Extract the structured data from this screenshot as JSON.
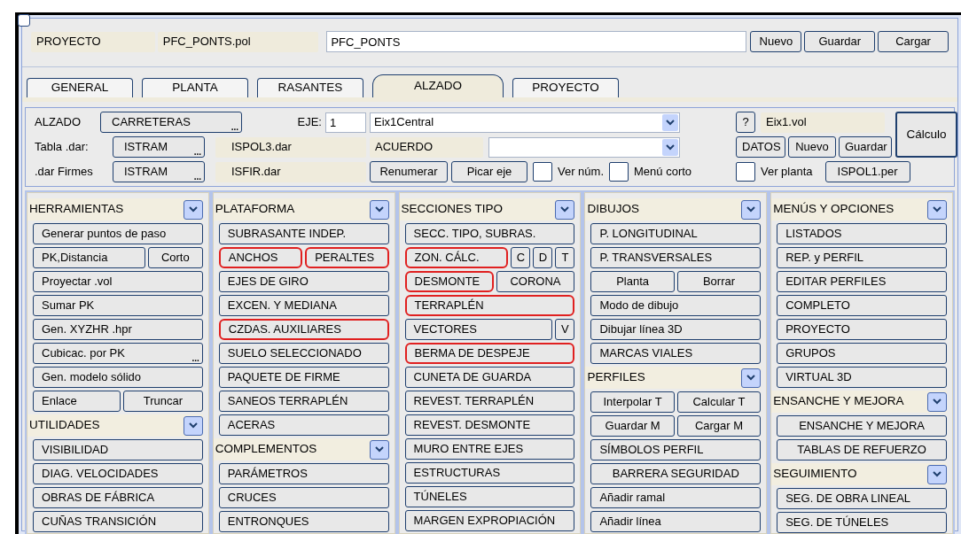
{
  "project": {
    "label": "PROYECTO",
    "file": "PFC_PONTS.pol",
    "name": "PFC_PONTS",
    "buttons": [
      "Nuevo",
      "Guardar",
      "Cargar"
    ]
  },
  "tabs": [
    {
      "label": "GENERAL",
      "selected": false
    },
    {
      "label": "PLANTA",
      "selected": false
    },
    {
      "label": "RASANTES",
      "selected": false
    },
    {
      "label": "ALZADO",
      "selected": true
    },
    {
      "label": "PROYECTO",
      "selected": false
    }
  ],
  "alzado": {
    "label": "ALZADO",
    "road_button": {
      "label": "CARRETERAS",
      "ellipsis": "..."
    },
    "eje_label": "EJE:",
    "eje_value": "1",
    "eje_combo": "Eix1Central",
    "help_button": "?",
    "vol_file": "Eix1.vol",
    "calc_button": "Cálculo",
    "tabla_label": "Tabla .dar:",
    "tabla_button": {
      "label": "ISTRAM",
      "ellipsis": "..."
    },
    "tabla_file": "ISPOL3.dar",
    "acuerdo_label": "ACUERDO",
    "datos_button": "DATOS",
    "nuevo_button": "Nuevo",
    "guardar_button": "Guardar",
    "firmes_label": ".dar Firmes",
    "firmes_button": {
      "label": "ISTRAM",
      "ellipsis": "..."
    },
    "firmes_file": "ISFIR.dar",
    "renumerar_button": "Renumerar",
    "picar_button": "Picar eje",
    "checks": [
      {
        "label": "Ver núm.",
        "checked": false
      },
      {
        "label": "Menú corto",
        "checked": false
      },
      {
        "label": "Ver planta",
        "checked": false
      }
    ],
    "per_button": "ISPOL1.per"
  },
  "columns": [
    [
      {
        "kind": "header",
        "label": "HERRAMIENTAS"
      },
      {
        "kind": "button",
        "label": "Generar puntos de paso",
        "highlighted": false
      },
      {
        "kind": "row",
        "buttons": [
          {
            "kind": "wide",
            "label": "PK,Distancia",
            "highlighted": false
          },
          {
            "kind": "narrow",
            "label": "Corto",
            "highlighted": false
          }
        ]
      },
      {
        "kind": "button",
        "label": "Proyectar .vol",
        "highlighted": false
      },
      {
        "kind": "button",
        "label": "Sumar PK",
        "highlighted": false
      },
      {
        "kind": "button",
        "label": "Gen. XYZHR .hpr",
        "highlighted": false
      },
      {
        "kind": "button",
        "label": "Cubicac. por PK",
        "ellipsis": "...",
        "highlighted": false
      },
      {
        "kind": "button",
        "label": "Gen. modelo sólido",
        "highlighted": false
      },
      {
        "kind": "row",
        "buttons": [
          {
            "kind": "wide",
            "label": "Enlace",
            "highlighted": false
          },
          {
            "kind": "half",
            "label": "Truncar",
            "highlighted": false
          }
        ]
      },
      {
        "kind": "header",
        "label": "UTILIDADES"
      },
      {
        "kind": "button",
        "label": "VISIBILIDAD",
        "highlighted": false
      },
      {
        "kind": "button",
        "label": "DIAG. VELOCIDADES",
        "highlighted": false
      },
      {
        "kind": "button",
        "label": "OBRAS DE FÁBRICA",
        "highlighted": false
      },
      {
        "kind": "button",
        "label": "CUÑAS TRANSICIÓN",
        "highlighted": false
      }
    ],
    [
      {
        "kind": "header",
        "label": "PLATAFORMA"
      },
      {
        "kind": "button",
        "label": "SUBRASANTE INDEP.",
        "highlighted": false
      },
      {
        "kind": "row",
        "buttons": [
          {
            "kind": "wide",
            "label": "ANCHOS",
            "highlighted": true
          },
          {
            "kind": "wide",
            "label": "PERALTES",
            "highlighted": true
          }
        ]
      },
      {
        "kind": "button",
        "label": "EJES DE GIRO",
        "highlighted": false
      },
      {
        "kind": "button",
        "label": "EXCEN. Y MEDIANA",
        "highlighted": false
      },
      {
        "kind": "button",
        "label": "CZDAS. AUXILIARES",
        "highlighted": true
      },
      {
        "kind": "button",
        "label": "SUELO SELECCIONADO",
        "highlighted": false
      },
      {
        "kind": "button",
        "label": "PAQUETE DE FIRME",
        "highlighted": false
      },
      {
        "kind": "button",
        "label": "SANEOS TERRAPLÉN",
        "highlighted": false
      },
      {
        "kind": "button",
        "label": "ACERAS",
        "highlighted": false
      },
      {
        "kind": "header",
        "label": "COMPLEMENTOS"
      },
      {
        "kind": "button",
        "label": "PARÁMETROS",
        "highlighted": false
      },
      {
        "kind": "button",
        "label": "CRUCES",
        "highlighted": false
      },
      {
        "kind": "button",
        "label": "ENTRONQUES",
        "highlighted": false
      }
    ],
    [
      {
        "kind": "header",
        "label": "SECCIONES TIPO"
      },
      {
        "kind": "button",
        "label": "SECC. TIPO, SUBRAS.",
        "highlighted": false
      },
      {
        "kind": "row",
        "buttons": [
          {
            "kind": "wide",
            "label": "ZON. CÁLC.",
            "highlighted": true
          },
          {
            "kind": "square",
            "label": "C",
            "highlighted": false
          },
          {
            "kind": "square",
            "label": "D",
            "highlighted": false
          },
          {
            "kind": "square",
            "label": "T",
            "highlighted": false
          }
        ]
      },
      {
        "kind": "row",
        "buttons": [
          {
            "kind": "wide",
            "label": "DESMONTE",
            "highlighted": true
          },
          {
            "kind": "half",
            "label": "CORONA",
            "highlighted": false
          }
        ]
      },
      {
        "kind": "button",
        "label": "TERRAPLÉN",
        "highlighted": true
      },
      {
        "kind": "row",
        "buttons": [
          {
            "kind": "wide",
            "label": "VECTORES",
            "highlighted": false
          },
          {
            "kind": "square",
            "label": "V",
            "highlighted": false
          }
        ]
      },
      {
        "kind": "button",
        "label": "BERMA DE DESPEJE",
        "highlighted": true
      },
      {
        "kind": "button",
        "label": "CUNETA DE GUARDA",
        "highlighted": false
      },
      {
        "kind": "button",
        "label": "REVEST. TERRAPLÉN",
        "highlighted": false
      },
      {
        "kind": "button",
        "label": "REVEST. DESMONTE",
        "highlighted": false
      },
      {
        "kind": "button",
        "label": "MURO ENTRE EJES",
        "highlighted": false
      },
      {
        "kind": "button",
        "label": "ESTRUCTURAS",
        "highlighted": false
      },
      {
        "kind": "button",
        "label": "TÚNELES",
        "highlighted": false
      },
      {
        "kind": "button",
        "label": "MARGEN EXPROPIACIÓN",
        "highlighted": false
      }
    ],
    [
      {
        "kind": "header",
        "label": "DIBUJOS"
      },
      {
        "kind": "button",
        "label": "P. LONGITUDINAL",
        "highlighted": false
      },
      {
        "kind": "button",
        "label": "P. TRANSVERSALES",
        "highlighted": false
      },
      {
        "kind": "row",
        "buttons": [
          {
            "kind": "half",
            "label": "Planta",
            "highlighted": false
          },
          {
            "kind": "half",
            "label": "Borrar",
            "highlighted": false
          }
        ]
      },
      {
        "kind": "button",
        "label": "Modo de dibujo",
        "highlighted": false
      },
      {
        "kind": "button",
        "label": "Dibujar línea 3D",
        "highlighted": false
      },
      {
        "kind": "button",
        "label": "MARCAS VIALES",
        "highlighted": false
      },
      {
        "kind": "header",
        "label": "PERFILES"
      },
      {
        "kind": "row",
        "buttons": [
          {
            "kind": "half",
            "label": "Interpolar T",
            "highlighted": false
          },
          {
            "kind": "half",
            "label": "Calcular T",
            "highlighted": false
          }
        ]
      },
      {
        "kind": "row",
        "buttons": [
          {
            "kind": "half",
            "label": "Guardar M",
            "highlighted": false
          },
          {
            "kind": "half",
            "label": "Cargar M",
            "highlighted": false
          }
        ]
      },
      {
        "kind": "button",
        "label": "SÍMBOLOS PERFIL",
        "highlighted": false
      },
      {
        "kind": "center",
        "label": "BARRERA SEGURIDAD",
        "highlighted": false
      },
      {
        "kind": "button",
        "label": "Añadir ramal",
        "highlighted": false
      },
      {
        "kind": "button",
        "label": "Añadir línea",
        "highlighted": false
      }
    ],
    [
      {
        "kind": "header",
        "label": "MENÚS Y OPCIONES"
      },
      {
        "kind": "button",
        "label": "LISTADOS",
        "highlighted": false
      },
      {
        "kind": "button",
        "label": "REP. y PERFIL",
        "highlighted": false
      },
      {
        "kind": "button",
        "label": "EDITAR PERFILES",
        "highlighted": false
      },
      {
        "kind": "button",
        "label": "COMPLETO",
        "highlighted": false
      },
      {
        "kind": "button",
        "label": "PROYECTO",
        "highlighted": false
      },
      {
        "kind": "button",
        "label": "GRUPOS",
        "highlighted": false
      },
      {
        "kind": "button",
        "label": "VIRTUAL 3D",
        "highlighted": false
      },
      {
        "kind": "header",
        "label": "ENSANCHE Y MEJORA"
      },
      {
        "kind": "center",
        "label": "ENSANCHE Y MEJORA",
        "highlighted": false
      },
      {
        "kind": "center",
        "label": "TABLAS DE REFUERZO",
        "highlighted": false
      },
      {
        "kind": "header",
        "label": "SEGUIMIENTO"
      },
      {
        "kind": "button",
        "label": "SEG. DE OBRA LINEAL",
        "highlighted": false
      },
      {
        "kind": "button",
        "label": "SEG. DE TÚNELES",
        "highlighted": false
      }
    ]
  ]
}
